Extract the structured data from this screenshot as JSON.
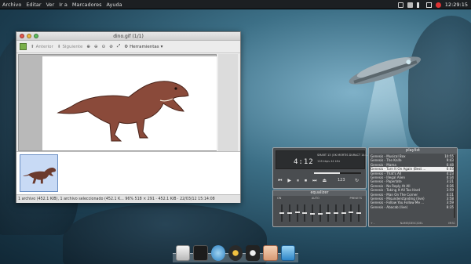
{
  "top_panel": {
    "menus": [
      "Archivo",
      "Editar",
      "Ver",
      "Ir a",
      "Marcadores",
      "Ayuda"
    ],
    "clock": "12:29:15"
  },
  "viewer": {
    "title": "dino.gif (1/1)",
    "toolbar": {
      "prev_label": "Anterior",
      "next_label": "Siguiente",
      "tools_label": "Herramientas"
    },
    "status": "1 archivo (452.1 KiB), 1 archivo seleccionado (452.1 K...   96%   518 × 291 · 452.1 KiB · 22/03/12 15:14:08"
  },
  "player": {
    "time": "4:12",
    "track_info": "SMART 13 (OK MORTIS DURACT 14:...)",
    "rate": "128 kbps 44 kHz",
    "volume": "123"
  },
  "equalizer": {
    "title": "equalizer",
    "labels": [
      "ON",
      "AUTO",
      "PRESETS"
    ],
    "bands": [
      0.5,
      0.5,
      0.45,
      0.5,
      0.55,
      0.55,
      0.5,
      0.5,
      0.5,
      0.45,
      0.5
    ]
  },
  "playlist": {
    "title": "playlist",
    "rows": [
      {
        "title": "Genesis - Musical Box",
        "time": "10:55"
      },
      {
        "title": "Genesis - The Knife",
        "time": "9:43"
      },
      {
        "title": "Genesis - Mama",
        "time": "6:48"
      },
      {
        "title": "Genesis - Turn It On Again (Best ...",
        "time": "6:05",
        "active": true
      },
      {
        "title": "Genesis - That's All",
        "time": "4:23"
      },
      {
        "title": "Genesis - Illegal Alien",
        "time": "4:34"
      },
      {
        "title": "Genesis - Paperlate",
        "time": "3:21"
      },
      {
        "title": "Genesis - No Reply At All",
        "time": "4:36"
      },
      {
        "title": "Genesis - Taking It All Too Hard",
        "time": "3:59"
      },
      {
        "title": "Genesis - Man On The Corner",
        "time": "4:11"
      },
      {
        "title": "Genesis - Misunderstanding (live)",
        "time": "3:58"
      },
      {
        "title": "Genesis - Follow You Follow Me ...",
        "time": "3:59"
      },
      {
        "title": "Genesis - Abacab (live)",
        "time": "8:35"
      }
    ],
    "footer_left": "+  -",
    "footer_mid": "NAME/DESC/DEL",
    "footer_right": "MISC"
  },
  "dock": {
    "items": [
      "file-manager",
      "terminal",
      "browser",
      "audio-player",
      "webcam",
      "eye-app",
      "folder"
    ]
  }
}
